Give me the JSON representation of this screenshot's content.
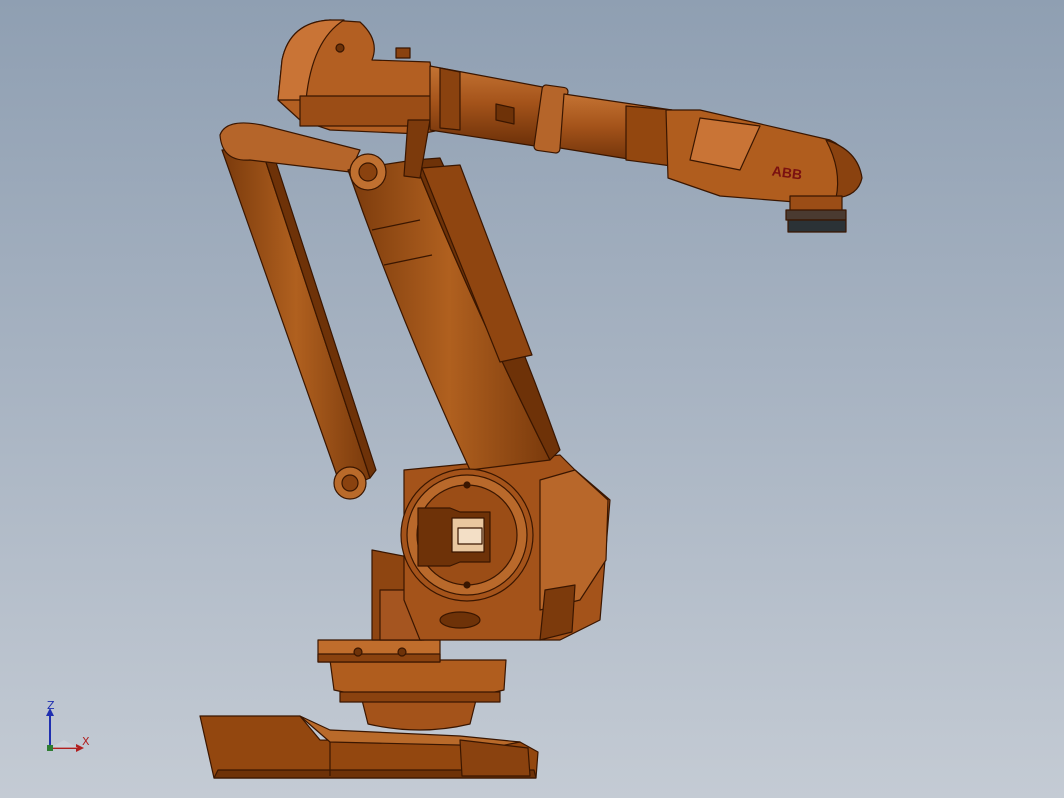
{
  "viewport": {
    "background_top": "#8f9fb2",
    "background_bottom": "#c4cbd4"
  },
  "model": {
    "brand_label": "ABB",
    "colors": {
      "body": "#a4531a",
      "body_dark": "#6e3208",
      "body_light": "#c97436",
      "edge": "#3a1600",
      "brand": "#7a1010",
      "flange": "#2b3236"
    }
  },
  "triad": {
    "z_label": "Z",
    "x_label": "X",
    "colors": {
      "z": "#1f2fb0",
      "x": "#b01f1f",
      "origin": "#2e7d32"
    },
    "icon": "coordinate-triad-icon"
  }
}
